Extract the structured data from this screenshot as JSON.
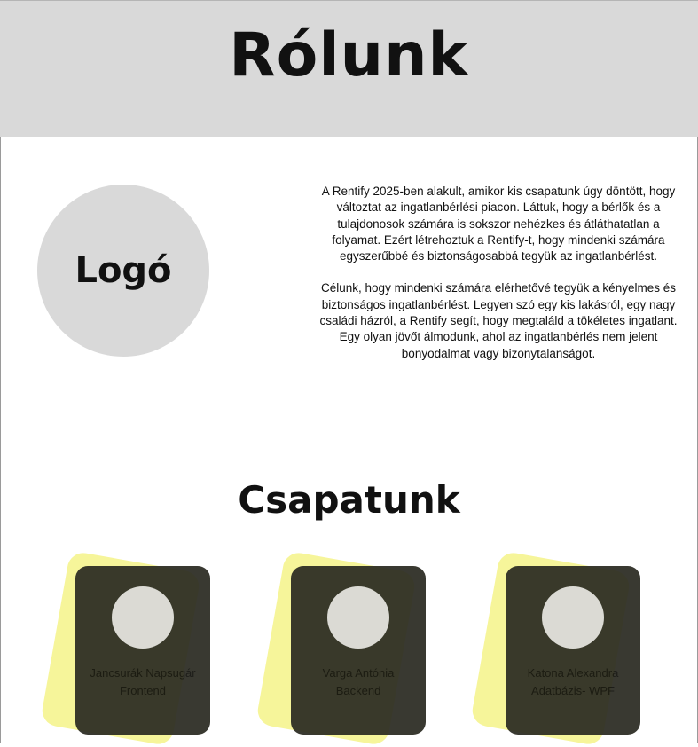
{
  "header": {
    "title": "Rólunk"
  },
  "about": {
    "logo_label": "Logó",
    "paragraphs": [
      "A Rentify 2025-ben alakult, amikor kis csapatunk úgy döntött, hogy változtat az ingatlanbérlési piacon. Láttuk, hogy a bérlők és a tulajdonosok számára is sokszor nehézkes és átláthatatlan a folyamat. Ezért létrehoztuk a Rentify-t, hogy mindenki számára egyszerűbbé és biztonságosabbá tegyük az ingatlanbérlést.",
      "Célunk, hogy mindenki számára elérhetővé tegyük a kényelmes és biztonságos ingatlanbérlést. Legyen szó egy kis lakásról, egy nagy családi házról, a Rentify segít, hogy megtaláld a tökéletes ingatlant. Egy olyan jövőt álmodunk, ahol az ingatlanbérlés nem jelent bonyodalmat vagy bizonytalanságot."
    ]
  },
  "team": {
    "title": "Csapatunk",
    "members": [
      {
        "name": "Jancsurák Napsugár",
        "role": "Frontend"
      },
      {
        "name": "Varga Antónia",
        "role": "Backend"
      },
      {
        "name": "Katona Alexandra",
        "role": "Adatbázis- WPF"
      }
    ]
  },
  "colors": {
    "header_bg": "#d9d9d9",
    "card_accent": "#f6f59a",
    "card_bg": "#2b2b22",
    "placeholder": "#d9d9d9"
  }
}
